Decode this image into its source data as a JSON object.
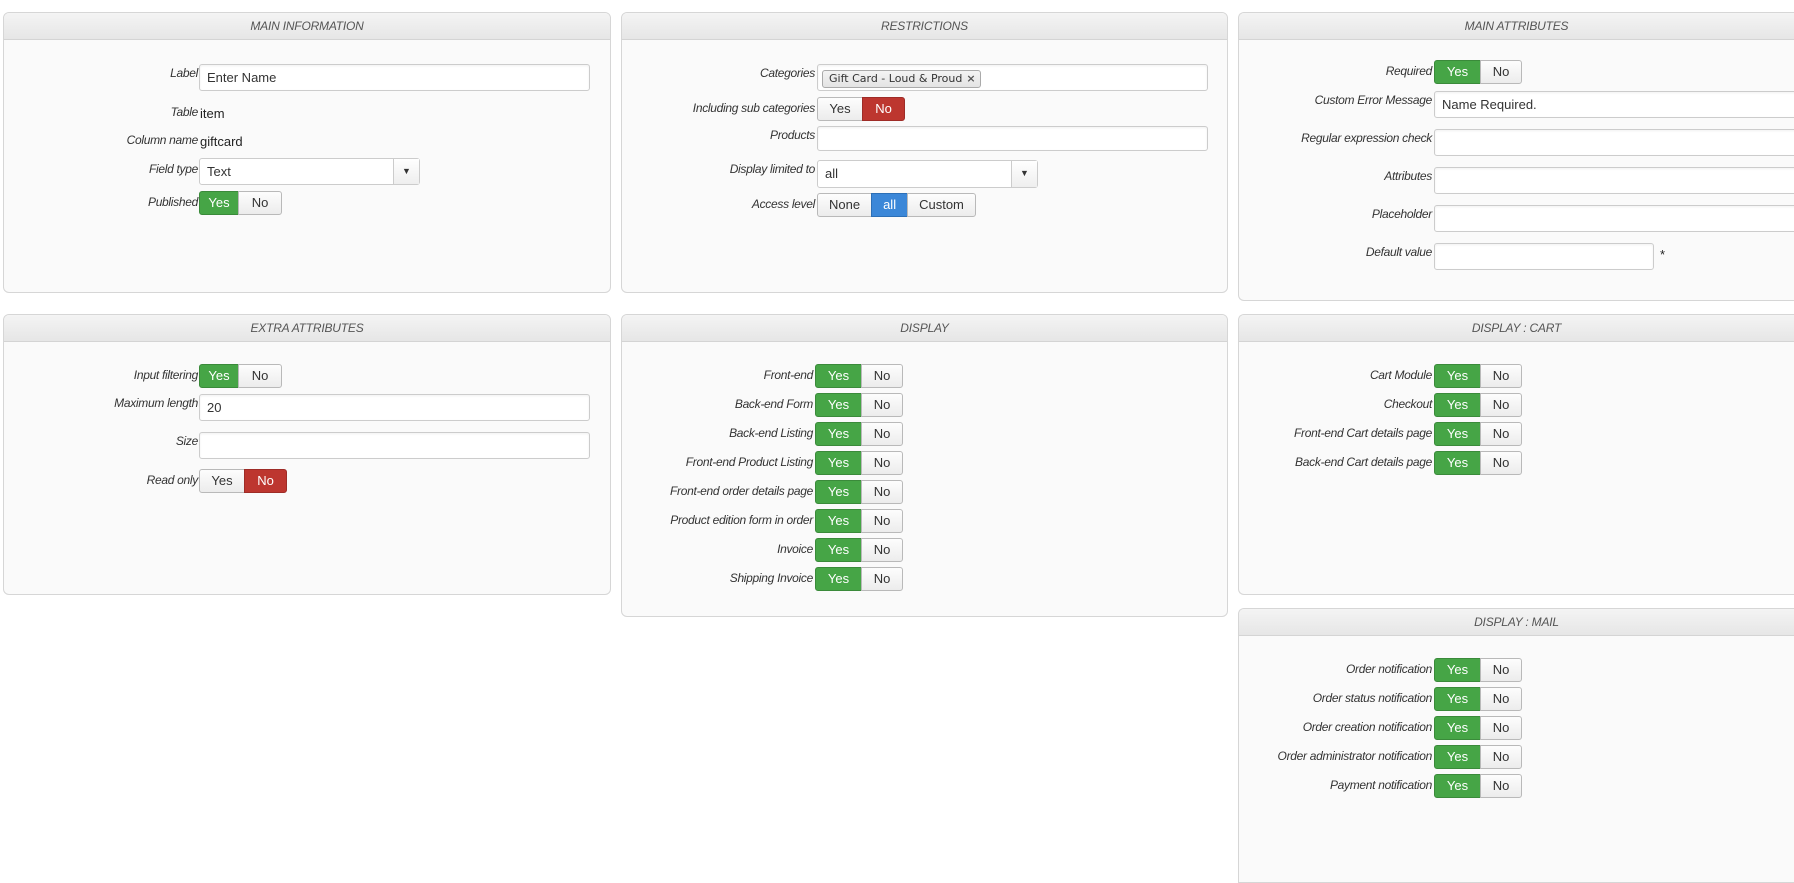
{
  "main_information": {
    "title": "MAIN INFORMATION",
    "label_label": "Label",
    "label_value": "Enter Name",
    "table_label": "Table",
    "table_value": "item",
    "column_label": "Column name",
    "column_value": "giftcard",
    "fieldtype_label": "Field type",
    "fieldtype_value": "Text",
    "published_label": "Published",
    "yes": "Yes",
    "no": "No"
  },
  "restrictions": {
    "title": "RESTRICTIONS",
    "categories_label": "Categories",
    "categories_tag": "Gift Card - Loud & Proud",
    "tag_remove": "×",
    "subcat_label": "Including sub categories",
    "products_label": "Products",
    "display_limited_label": "Display limited to",
    "display_limited_value": "all",
    "access_label": "Access level",
    "access_options": [
      "None",
      "all",
      "Custom"
    ],
    "yes": "Yes",
    "no": "No"
  },
  "main_attributes": {
    "title": "MAIN ATTRIBUTES",
    "required_label": "Required",
    "custom_error_label": "Custom Error Message",
    "custom_error_value": "Name Required.",
    "regex_label": "Regular expression check",
    "attributes_label": "Attributes",
    "placeholder_label": "Placeholder",
    "default_label": "Default value",
    "asterisk": "*",
    "yes": "Yes",
    "no": "No"
  },
  "extra_attributes": {
    "title": "EXTRA ATTRIBUTES",
    "filtering_label": "Input filtering",
    "maxlen_label": "Maximum length",
    "maxlen_value": "20",
    "size_label": "Size",
    "readonly_label": "Read only",
    "yes": "Yes",
    "no": "No"
  },
  "display": {
    "title": "DISPLAY",
    "rows": [
      "Front-end",
      "Back-end Form",
      "Back-end Listing",
      "Front-end Product Listing",
      "Front-end order details page",
      "Product edition form in order",
      "Invoice",
      "Shipping Invoice"
    ],
    "yes": "Yes",
    "no": "No"
  },
  "display_cart": {
    "title": "DISPLAY : CART",
    "rows": [
      "Cart Module",
      "Checkout",
      "Front-end Cart details page",
      "Back-end Cart details page"
    ],
    "yes": "Yes",
    "no": "No"
  },
  "display_mail": {
    "title": "DISPLAY : MAIL",
    "rows": [
      "Order notification",
      "Order status notification",
      "Order creation notification",
      "Order administrator notification",
      "Payment notification"
    ],
    "yes": "Yes",
    "no": "No"
  }
}
